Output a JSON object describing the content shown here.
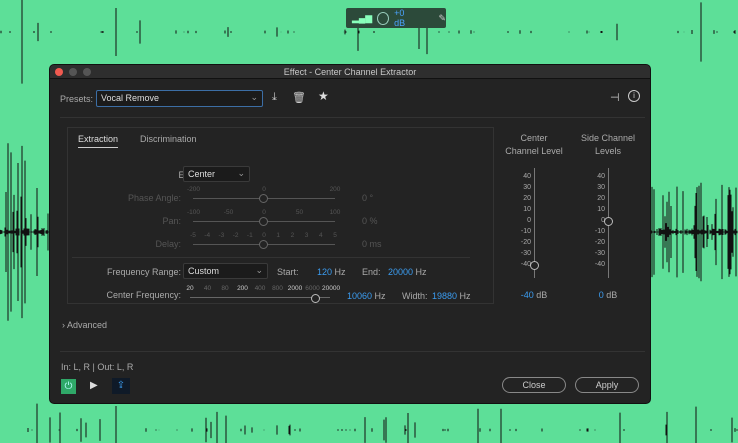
{
  "hud": {
    "gain": "+0 dB",
    "icons": [
      "meter-icon",
      "knob-icon",
      "pin-icon"
    ]
  },
  "dialog": {
    "title": "Effect - Center Channel Extractor",
    "presets_label": "Presets:",
    "preset_value": "Vocal Remove",
    "tabs": [
      {
        "label": "Extraction",
        "active": true
      },
      {
        "label": "Discrimination",
        "active": false
      }
    ],
    "extract": {
      "label": "Extract:",
      "value": "Center"
    },
    "phase": {
      "label": "Phase Angle:",
      "ticks": [
        "-200",
        "0",
        "200"
      ],
      "value": "0 °",
      "position": 0.5
    },
    "pan": {
      "label": "Pan:",
      "ticks": [
        "-100",
        "-50",
        "0",
        "50",
        "100"
      ],
      "value": "0 %",
      "position": 0.5
    },
    "delay": {
      "label": "Delay:",
      "ticks": [
        "-5",
        "-4",
        "-3",
        "-2",
        "-1",
        "0",
        "1",
        "2",
        "3",
        "4",
        "5"
      ],
      "value": "0 ms",
      "position": 0.5
    },
    "freq_range": {
      "label": "Frequency Range:",
      "value": "Custom",
      "start_label": "Start:",
      "start": "120",
      "end_label": "End:",
      "end": "20000",
      "unit": "Hz"
    },
    "center_freq": {
      "label": "Center Frequency:",
      "ticks": [
        "20",
        "40",
        "80",
        "200",
        "400",
        "800",
        "2000",
        "6000",
        "20000"
      ],
      "value": "10060",
      "unit": "Hz",
      "width_label": "Width:",
      "width": "19880"
    },
    "meters": [
      {
        "title1": "Center",
        "title2": "Channel Level",
        "value": "-40",
        "unit": "dB",
        "level": -40
      },
      {
        "title1": "Side Channel",
        "title2": "Levels",
        "value": "0",
        "unit": "dB",
        "level": 0
      }
    ],
    "meter_scale": [
      "40",
      "30",
      "20",
      "10",
      "0",
      "-10",
      "-20",
      "-30",
      "-40"
    ],
    "advanced": "Advanced",
    "io": "In: L, R | Out: L, R",
    "close": "Close",
    "apply": "Apply",
    "accent": "#3b9cf0"
  }
}
